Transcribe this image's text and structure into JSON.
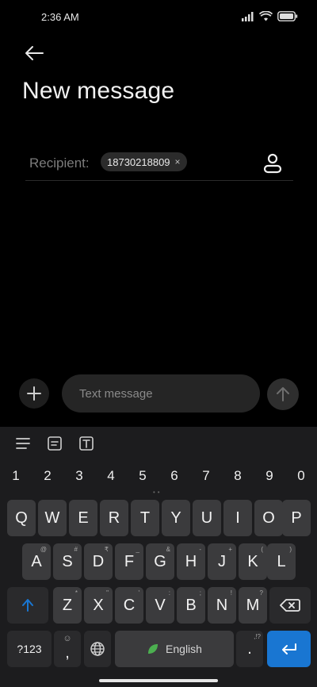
{
  "status_bar": {
    "time": "2:36 AM"
  },
  "header": {
    "title": "New message"
  },
  "recipient": {
    "label": "Recipient:",
    "chips": [
      "18730218809"
    ],
    "chip_close": "×"
  },
  "compose": {
    "placeholder": "Text message"
  },
  "keyboard": {
    "numbers": [
      "1",
      "2",
      "3",
      "4",
      "5",
      "6",
      "7",
      "8",
      "9",
      "0"
    ],
    "row1": [
      "Q",
      "W",
      "E",
      "R",
      "T",
      "Y",
      "U",
      "I",
      "O",
      "P"
    ],
    "row2": [
      "A",
      "S",
      "D",
      "F",
      "G",
      "H",
      "J",
      "K",
      "L"
    ],
    "row2_hints": [
      "@",
      "#",
      "₹",
      "_",
      "&",
      "-",
      "+",
      "(",
      ")"
    ],
    "row3": [
      "Z",
      "X",
      "C",
      "V",
      "B",
      "N",
      "M"
    ],
    "row3_hints": [
      "*",
      "\"",
      "'",
      ":",
      ";",
      "!",
      "?"
    ],
    "symbols_label": "?123",
    "comma_label": ",",
    "space_label": "English",
    "period_label": ".",
    "period_hint": ",!?",
    "accent_color": "#1976d2"
  }
}
